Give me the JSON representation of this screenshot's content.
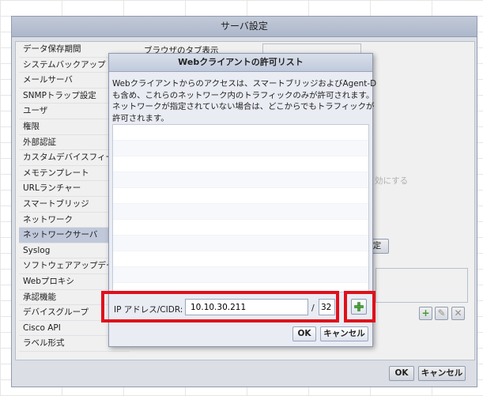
{
  "outer": {
    "title": "サーバ設定",
    "ok_label": "OK",
    "cancel_label": "キャンセル"
  },
  "sidebar": {
    "items": [
      {
        "label": "データ保存期間"
      },
      {
        "label": "システムバックアップ"
      },
      {
        "label": "メールサーバ"
      },
      {
        "label": "SNMPトラップ設定"
      },
      {
        "label": "ユーザ"
      },
      {
        "label": "権限"
      },
      {
        "label": "外部認証"
      },
      {
        "label": "カスタムデバイスフィール"
      },
      {
        "label": "メモテンプレート"
      },
      {
        "label": "URLランチャー"
      },
      {
        "label": "スマートブリッジ"
      },
      {
        "label": "ネットワーク"
      },
      {
        "label": "ネットワークサーバ",
        "selected": true
      },
      {
        "label": "Syslog"
      },
      {
        "label": "ソフトウェアアップデー"
      },
      {
        "label": "Webプロキシ"
      },
      {
        "label": "承認機能"
      },
      {
        "label": "デバイスグループ"
      },
      {
        "label": "Cisco API"
      },
      {
        "label": "ラベル形式"
      }
    ]
  },
  "background": {
    "partial_heading": "ブラウザのタブ表示",
    "disable_hint": "効にする",
    "settings_button_fragment": "定"
  },
  "dialog": {
    "title": "Webクライアントの許可リスト",
    "description_lines": [
      "Webクライアントからのアクセスは、スマートブリッジおよびAgent-D",
      "も含め、これらのネットワーク内のトラフィックのみが許可されます。",
      "ネットワークが指定されていない場合は、どこからでもトラフィックが",
      "許可されます。"
    ],
    "cidr_label": "IP アドレス/CIDR:",
    "ip_value": "10.10.30.211",
    "prefix_value": "32",
    "slash": "/",
    "add_icon": "plus-icon",
    "ok_label": "OK",
    "cancel_label": "キャンセル"
  },
  "colors": {
    "highlight": "#e0101b",
    "selected_row": "#cdd5e8",
    "plus_green": "#4aa43a"
  }
}
